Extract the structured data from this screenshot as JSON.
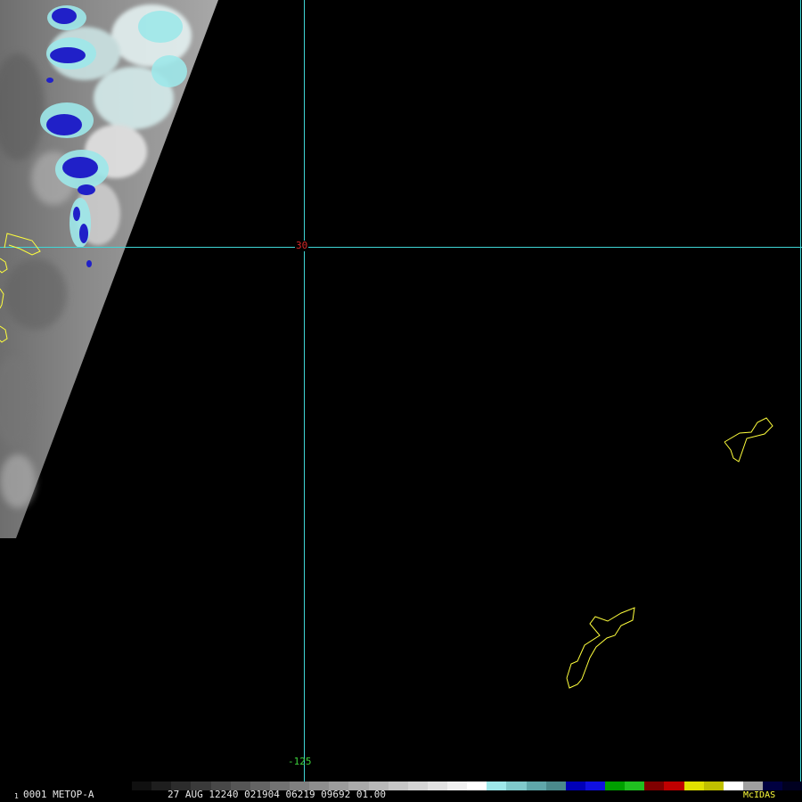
{
  "grid": {
    "lat_label": "30",
    "lon_label": "-125",
    "line_color": "#3fd6d6"
  },
  "status_bar": {
    "frame_number": "1",
    "frame_id": "0001 METOP-A",
    "scan_info": "27 AUG 12240 021904 06219 09692 01.00",
    "software": "McIDAS"
  },
  "colors": {
    "coastline": "#ffff3c",
    "lat_label": "#d62828",
    "lon_label": "#3ccf3c",
    "text": "#e8e8e8"
  },
  "colorbar": [
    "#101010",
    "#1e1e1e",
    "#2c2c2c",
    "#3a3a3a",
    "#484848",
    "#565656",
    "#646464",
    "#727272",
    "#808080",
    "#8e8e8e",
    "#9c9c9c",
    "#aaaaaa",
    "#b8b8b8",
    "#c6c6c6",
    "#d4d4d4",
    "#e2e2e2",
    "#f0f0f0",
    "#ffffff",
    "#9ee8ea",
    "#7fc9cb",
    "#5fa7aa",
    "#4a8a8c",
    "#0000b8",
    "#1010e0",
    "#00a000",
    "#20c020",
    "#800000",
    "#c00000",
    "#e0e000",
    "#c0c000",
    "#ffffff",
    "#a0a0a0",
    "#000040",
    "#000020"
  ]
}
